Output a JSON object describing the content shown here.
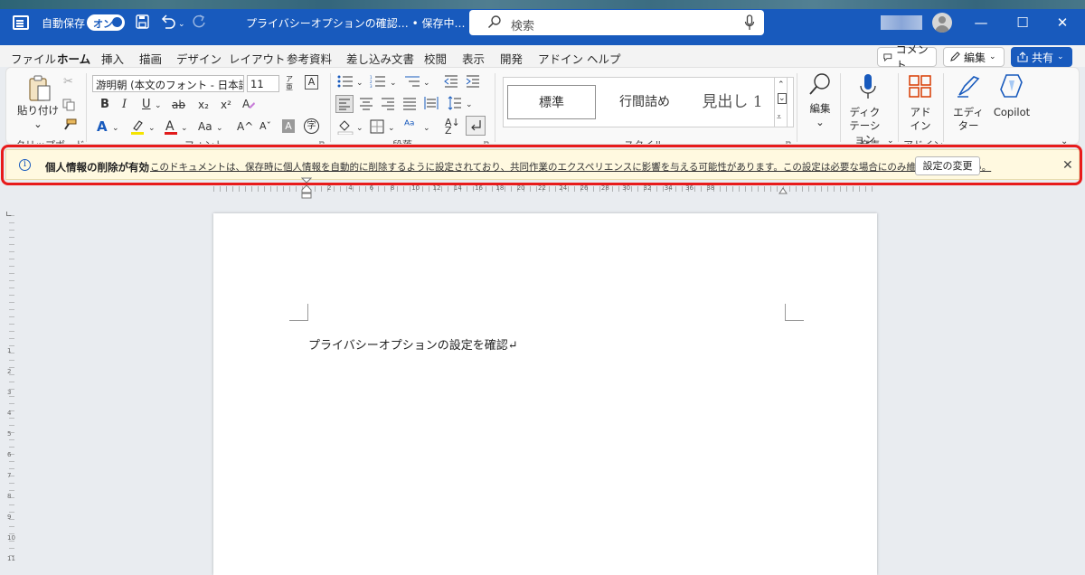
{
  "titlebar": {
    "autosave_label": "自動保存",
    "autosave_state": "オン",
    "doc_title": "プライバシーオプションの確認… • 保存中… ⌄",
    "search_placeholder": "検索",
    "min_glyph": "—",
    "max_glyph": "☐",
    "close_glyph": "✕"
  },
  "menu": {
    "tabs": [
      "ファイル",
      "ホーム",
      "挿入",
      "描画",
      "デザイン",
      "レイアウト",
      "参考資料",
      "差し込み文書",
      "校閲",
      "表示",
      "開発",
      "アドイン",
      "ヘルプ"
    ],
    "comment_label": "コメント",
    "edit_label": "編集",
    "share_label": "共有"
  },
  "ribbon": {
    "clipboard": {
      "paste_label": "貼り付け",
      "group_label": "クリップボード"
    },
    "font": {
      "font_name": "游明朝 (本文のフォント - 日本語)",
      "font_size": "11",
      "bold": "B",
      "italic": "I",
      "underline": "U",
      "strike": "ab",
      "subscript": "x₂",
      "superscript": "x²",
      "change_case": "Aa",
      "grow": "A^",
      "shrink": "Aˇ",
      "group_label": "フォント"
    },
    "paragraph": {
      "group_label": "段落"
    },
    "styles": {
      "items": [
        "標準",
        "行間詰め",
        "見出し 1"
      ],
      "group_label": "スタイル"
    },
    "editing": {
      "label": "編集"
    },
    "voice": {
      "dictate_label": "ディクテーション",
      "group_label": "音声"
    },
    "addins": {
      "label": "アドイン",
      "group_label": "アドイン"
    },
    "editor": {
      "label": "エディター"
    },
    "copilot": {
      "label": "Copilot"
    }
  },
  "notification": {
    "title": "個人情報の削除が有効",
    "message": "このドキュメントは、保存時に個人情報を自動的に削除するように設定されており、共同作業のエクスペリエンスに影響を与える可能性があります。この設定は必要な場合にのみ維持してください。",
    "button_label": "設定の変更",
    "close_glyph": "✕"
  },
  "document": {
    "text": "プライバシーオプションの設定を確認↵"
  },
  "rulers": {
    "h_numbers": [
      "2",
      "4",
      "6",
      "8",
      "10",
      "12",
      "14",
      "16",
      "18",
      "20",
      "22",
      "24",
      "26",
      "28",
      "30",
      "32",
      "34",
      "36",
      "38"
    ],
    "v_numbers": [
      "1",
      "2",
      "3",
      "4",
      "5",
      "6",
      "7",
      "8",
      "9",
      "10",
      "11"
    ]
  },
  "colors": {
    "accent": "#185abd",
    "notification_bg": "#fff9e0",
    "highlight_outline": "#e81b1b"
  }
}
